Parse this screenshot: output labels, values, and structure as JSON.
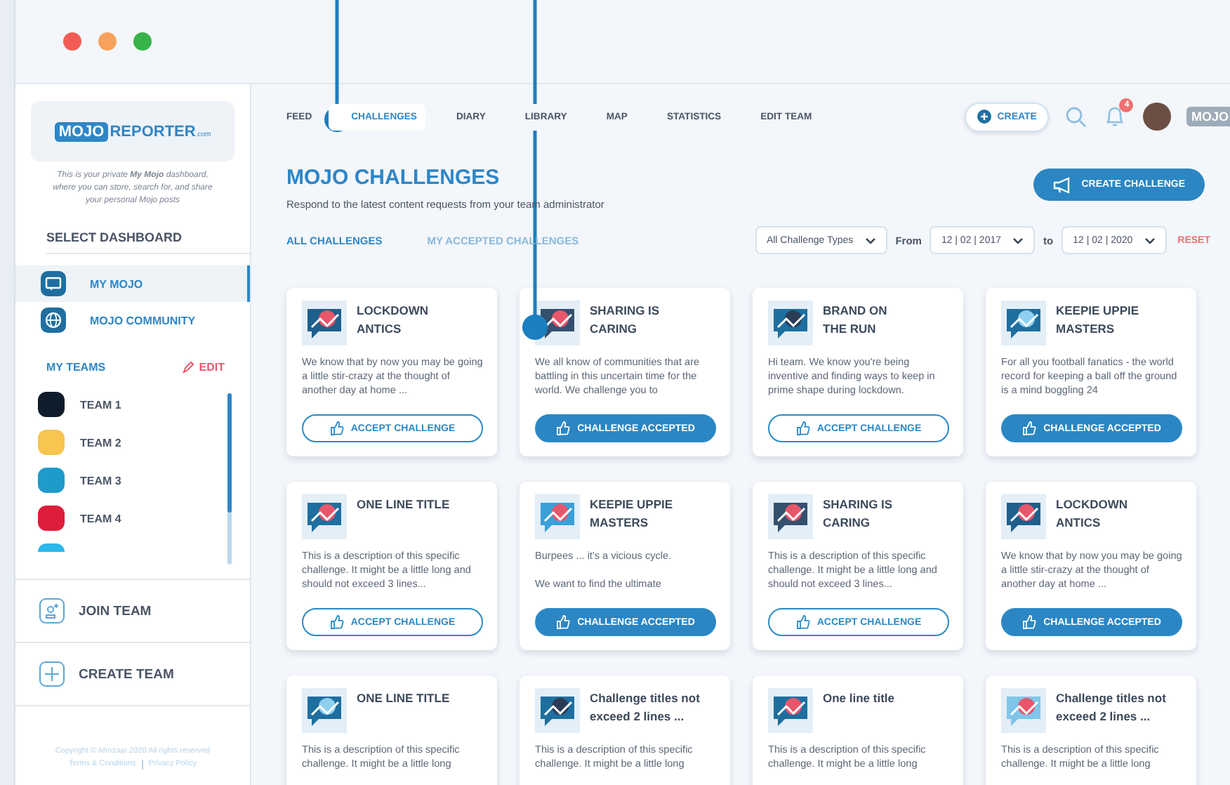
{
  "sidebar": {
    "logo": {
      "main": "MOJO",
      "second": "REPORTER",
      "suffix": ".com"
    },
    "intro": "This is your private **My Mojo** dashboard, where you can store, search for, and share your personal Mojo posts",
    "section_title": "SELECT DASHBOARD",
    "dashboards": [
      {
        "label": "MY MOJO",
        "kind": "chat",
        "selected": true
      },
      {
        "label": "MOJO COMMUNITY",
        "kind": "globe",
        "selected": false
      }
    ],
    "teams_title": "MY TEAMS",
    "edit_label": "EDIT",
    "teams": [
      {
        "name": "TEAM 1",
        "color": "#0f1c2b"
      },
      {
        "name": "TEAM 2",
        "color": "#f7c550"
      },
      {
        "name": "TEAM 3",
        "color": "#1e9acb"
      },
      {
        "name": "TEAM 4",
        "color": "#dc1e3c"
      },
      {
        "color": "#2bb7ea"
      }
    ],
    "join_team": "JOIN TEAM",
    "create_team": "CREATE TEAM",
    "copyright": "Copyright © Afrozaar 2020 All rights reserved",
    "terms": "Terms & Conditions",
    "privacy": "Privacy Policy"
  },
  "nav": {
    "items": [
      {
        "label": "FEED",
        "selected": false
      },
      {
        "label": "CHALLENGES",
        "selected": true
      },
      {
        "label": "DIARY",
        "selected": false
      },
      {
        "label": "LIBRARY",
        "selected": false
      },
      {
        "label": "MAP",
        "selected": false
      },
      {
        "label": "STATISTICS",
        "selected": false
      },
      {
        "label": "EDIT TEAM",
        "selected": false
      }
    ],
    "create_button": "CREATE",
    "notification_count": "4",
    "brand": "MOJO"
  },
  "header": {
    "title": "MOJO CHALLENGES",
    "subtitle": "Respond to the latest content requests from your team administrator",
    "create_challenge": "CREATE CHALLENGE"
  },
  "tabs": [
    {
      "label": "ALL CHALLENGES",
      "selected": true
    },
    {
      "label": "MY ACCEPTED CHALLENGES",
      "selected": false
    }
  ],
  "filters": {
    "type": "All Challenge Types",
    "from_label": "From",
    "from": "12 | 02 | 2017",
    "to_label": "to",
    "to": "12 | 02 | 2020",
    "reset": "RESET"
  },
  "cards": [
    {
      "kind": "lockdown",
      "title": "LOCKDOWN\nANTICS",
      "description": "We know that by now you may be going a little stir-crazy at the thought of another day at home ...",
      "accepted": false,
      "button": "ACCEPT CHALLENGE"
    },
    {
      "kind": "sharing",
      "title": "SHARING IS\nCARING",
      "description": "We all know of communities that are battling in this uncertain time for the world. We challenge you to",
      "accepted": true,
      "button": "CHALLENGE ACCEPTED"
    },
    {
      "kind": "run",
      "title": "BRAND ON\nTHE RUN",
      "description": "Hi team. We know you're being inventive and finding ways to keep in prime shape during lockdown.",
      "accepted": false,
      "button": "ACCEPT CHALLENGE"
    },
    {
      "kind": "keepie",
      "title": "KEEPIE UPPIE\nMASTERS",
      "description": "For all you football fanatics - the world record for keeping a ball off the ground is a mind boggling 24",
      "accepted": true,
      "button": "CHALLENGE ACCEPTED"
    },
    {
      "kind": "oneline",
      "title": "ONE LINE TITLE",
      "description": "This is a description of this specific challenge. It might be a little long and should not exceed 3 lines...",
      "accepted": false,
      "button": "ACCEPT CHALLENGE"
    },
    {
      "kind": "ball",
      "title": "KEEPIE UPPIE\nMASTERS",
      "description": "Burpees ... it's a vicious cycle.\n\nWe want to find the ultimate",
      "accepted": true,
      "button": "CHALLENGE ACCEPTED"
    },
    {
      "kind": "sharing",
      "title": "SHARING IS\nCARING",
      "description": "This is a description of this specific challenge. It might be a little long and should not exceed 3 lines...",
      "accepted": false,
      "button": "ACCEPT CHALLENGE"
    },
    {
      "kind": "lockdown",
      "title": "LOCKDOWN\nANTICS",
      "description": "We know that by now you may be going a little stir-crazy at the thought of another day at home ...",
      "accepted": true,
      "button": "CHALLENGE ACCEPTED"
    },
    {
      "kind": "keepie",
      "title": "ONE LINE TITLE",
      "description": "This is a description of this specific challenge. It might be a little long"
    },
    {
      "kind": "run",
      "title": "Challenge titles not\nexceed 2 lines ...",
      "description": "This is a description of this specific challenge. It might be a little long"
    },
    {
      "kind": "oneline",
      "title": "One line title",
      "description": "This is a description of this specific challenge. It might be a little long"
    },
    {
      "kind": "water",
      "title": "Challenge titles not\nexceed 2 lines ...",
      "description": "This is a description of this specific challenge. It might be a little long"
    }
  ]
}
